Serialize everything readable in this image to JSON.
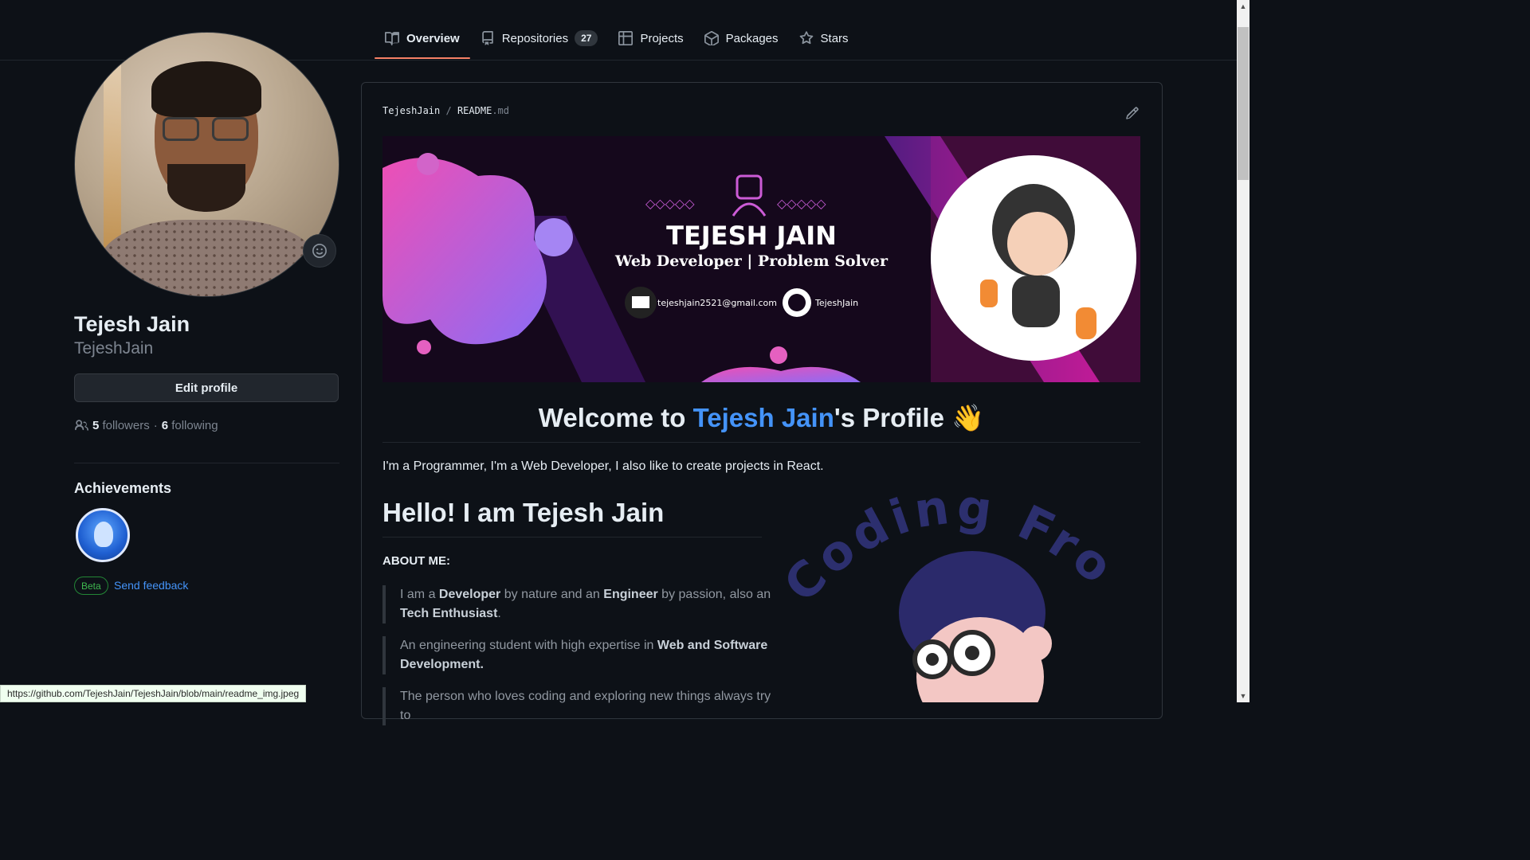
{
  "nav": {
    "tabs": [
      {
        "label": "Overview",
        "icon": "book-icon",
        "active": true
      },
      {
        "label": "Repositories",
        "icon": "repo-icon",
        "count": "27"
      },
      {
        "label": "Projects",
        "icon": "table-icon"
      },
      {
        "label": "Packages",
        "icon": "package-icon"
      },
      {
        "label": "Stars",
        "icon": "star-icon"
      }
    ]
  },
  "profile": {
    "name": "Tejesh Jain",
    "login": "TejeshJain",
    "edit_label": "Edit profile",
    "followers_count": "5",
    "followers_label": "followers",
    "following_count": "6",
    "following_label": "following",
    "dot": "·"
  },
  "achievements": {
    "title": "Achievements",
    "beta_label": "Beta",
    "feedback_label": "Send feedback"
  },
  "readme": {
    "owner": "TejeshJain",
    "slash": "/",
    "file": "README",
    "ext": ".md",
    "banner": {
      "name": "TEJESH JAIN",
      "role": "Web Developer  |  Problem Solver",
      "email": "tejeshjain2521@gmail.com",
      "github": "TejeshJain"
    },
    "welcome_prefix": "Welcome to ",
    "welcome_name": "Tejesh Jain",
    "welcome_suffix": "'s Profile 👋",
    "intro": "I'm a Programmer, I'm a Web Developer, I also like to create projects in React.",
    "heading": "Hello! I am Tejesh Jain",
    "about_label": "ABOUT ME:",
    "quotes": {
      "q1": {
        "a": "I am a ",
        "b": "Developer",
        "c": " by nature and an ",
        "d": "Engineer",
        "e": " by passion, also an ",
        "f": "Tech Enthusiast",
        "g": "."
      },
      "q2": {
        "a": "An engineering student with high expertise in ",
        "b": "Web and Software Development."
      },
      "q3": {
        "a": "The person who loves coding and exploring new things always try to"
      }
    },
    "coding_text": "Coding From"
  },
  "status_url": "https://github.com/TejeshJain/TejeshJain/blob/main/readme_img.jpeg",
  "colors": {
    "accent": "#4493f8",
    "tab_underline": "#f78166",
    "beta": "#3fb950"
  }
}
